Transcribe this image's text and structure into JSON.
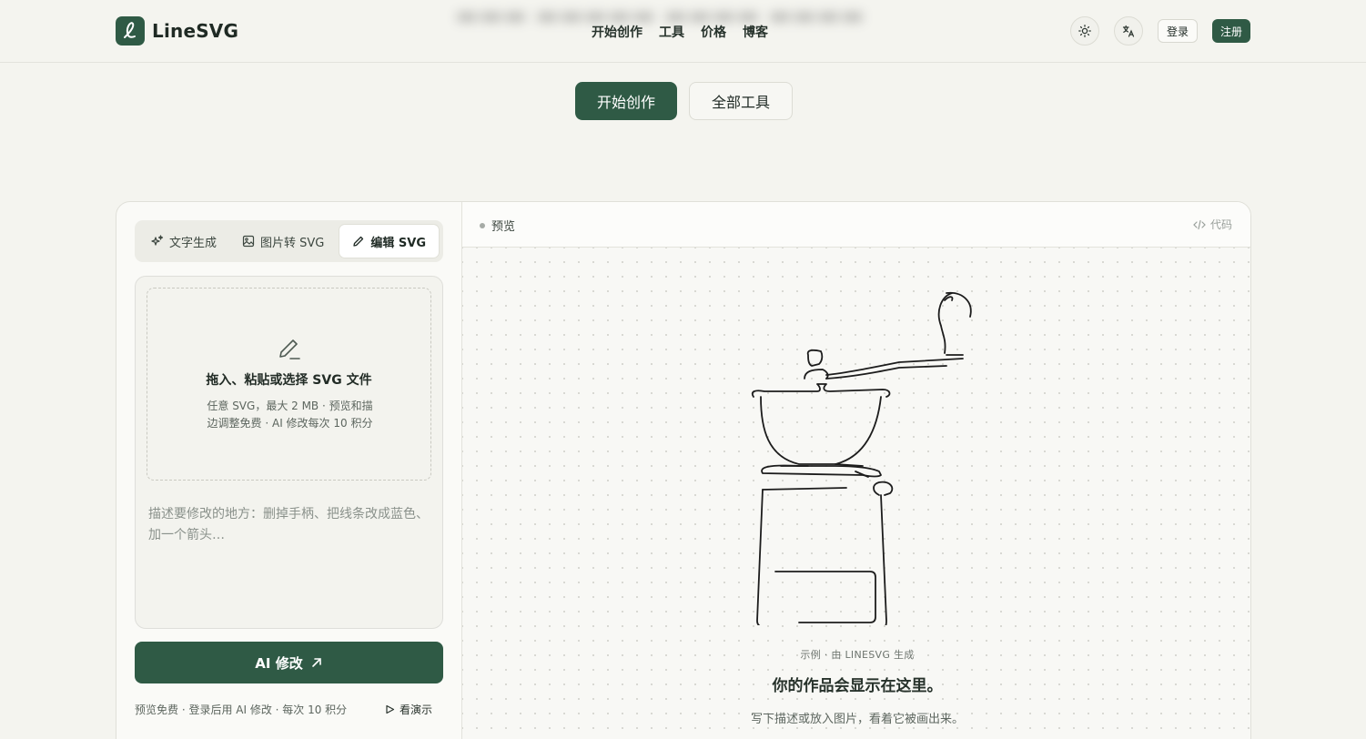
{
  "header": {
    "logo_text": "LineSVG",
    "nav": [
      "开始创作",
      "工具",
      "价格",
      "博客"
    ],
    "login_label": "登录",
    "signup_label": "注册"
  },
  "hero": {
    "primary_label": "开始创作",
    "secondary_label": "全部工具"
  },
  "tabs": [
    {
      "label": "文字生成",
      "icon": "sparkles-icon",
      "active": false
    },
    {
      "label": "图片转 SVG",
      "icon": "image-icon",
      "active": false
    },
    {
      "label": "编辑 SVG",
      "icon": "pencil-icon",
      "active": true
    }
  ],
  "dropzone": {
    "title": "拖入、粘贴或选择 SVG 文件",
    "description": "任意 SVG，最大 2 MB · 预览和描边调整免费 · AI 修改每次 10 积分"
  },
  "prompt_placeholder": "描述要修改的地方：删掉手柄、把线条改成蓝色、加一个箭头…",
  "ai_button_label": "AI 修改",
  "footer_note": "预览免费 · 登录后用 AI 修改 · 每次 10 积分",
  "demo_label": "看演示",
  "preview": {
    "label": "预览",
    "code_label": "代码",
    "caption": "示例 · 由 LINESVG 生成",
    "empty_title": "你的作品会显示在这里。",
    "empty_subtitle": "写下描述或放入图片，看着它被画出来。"
  },
  "colors": {
    "accent": "#2f5a45",
    "background": "#f4f4ef"
  }
}
